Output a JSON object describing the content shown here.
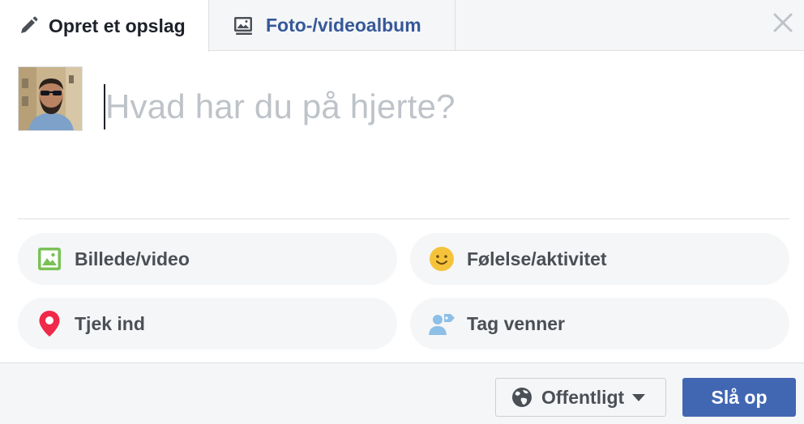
{
  "tabs": {
    "create_post": {
      "label": "Opret et opslag",
      "icon": "pencil-icon"
    },
    "photo_album": {
      "label": "Foto-/videoalbum",
      "icon": "album-icon"
    },
    "close_icon": "close-icon"
  },
  "composer": {
    "placeholder": "Hvad har du på hjerte?",
    "avatar": "avatar"
  },
  "actions": [
    {
      "label": "Billede/video",
      "icon": "photo-icon",
      "color": "#7ac157"
    },
    {
      "label": "Følelse/aktivitet",
      "icon": "smiley-icon",
      "color": "#f5c33b"
    },
    {
      "label": "Tjek ind",
      "icon": "location-pin-icon",
      "color": "#f02849"
    },
    {
      "label": "Tag venner",
      "icon": "tag-friends-icon",
      "color": "#8ebfe6"
    }
  ],
  "footer": {
    "audience_label": "Offentligt",
    "audience_icon": "globe-icon",
    "post_label": "Slå op"
  },
  "colors": {
    "primary": "#4267b2",
    "link": "#365899",
    "placeholder": "#bec3c9"
  }
}
